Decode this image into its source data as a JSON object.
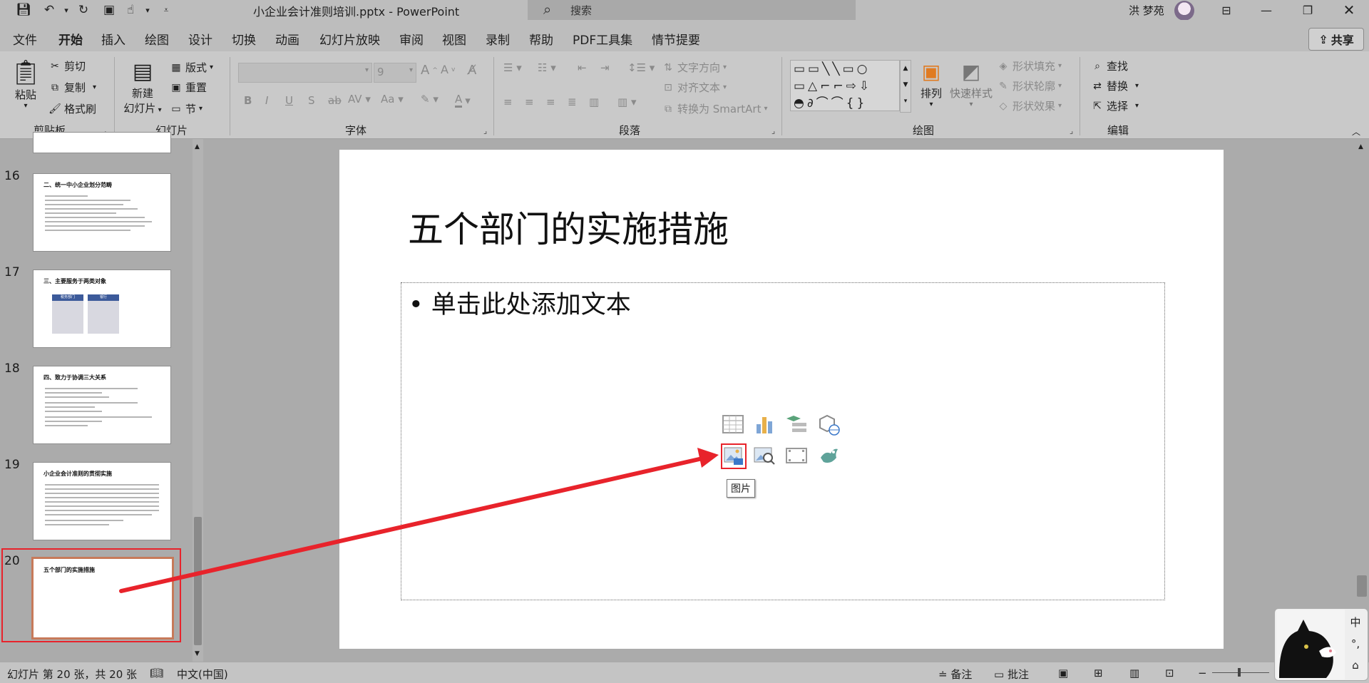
{
  "window": {
    "doc_title": "小企业会计准则培训.pptx  -  PowerPoint",
    "search_placeholder": "搜索",
    "user_name": "洪 梦苑",
    "qat_icons": [
      "save-icon",
      "undo-icon",
      "redo-icon",
      "presenter-icon",
      "touch-mode-icon",
      "customize-icon"
    ]
  },
  "tabs": [
    "文件",
    "开始",
    "插入",
    "绘图",
    "设计",
    "切换",
    "动画",
    "幻灯片放映",
    "审阅",
    "视图",
    "录制",
    "帮助",
    "PDF工具集",
    "情节提要"
  ],
  "active_tab": "开始",
  "share_label": "共享",
  "ribbon": {
    "clipboard": {
      "paste": "粘贴",
      "cut": "剪切",
      "copy": "复制",
      "format_painter": "格式刷",
      "group": "剪贴板"
    },
    "slides": {
      "new_slide_line1": "新建",
      "new_slide_line2": "幻灯片",
      "layout": "版式",
      "reset": "重置",
      "section": "节",
      "group": "幻灯片"
    },
    "font": {
      "size": "9",
      "group": "字体"
    },
    "paragraph": {
      "text_direction": "文字方向",
      "align_text": "对齐文本",
      "smartart": "转换为 SmartArt",
      "group": "段落"
    },
    "drawing": {
      "arrange": "排列",
      "quick_styles": "快速样式",
      "shape_fill": "形状填充",
      "shape_outline": "形状轮廓",
      "shape_effects": "形状效果",
      "group": "绘图"
    },
    "editing": {
      "find": "查找",
      "replace": "替换",
      "select": "选择",
      "group": "编辑"
    }
  },
  "thumbnails": [
    {
      "num": "16",
      "title": "二、统一中小企业划分范畴"
    },
    {
      "num": "17",
      "title": "三、主要服务于两类对象",
      "box1": "税务部门",
      "box2": "银行"
    },
    {
      "num": "18",
      "title": "四、致力于协调三大关系"
    },
    {
      "num": "19",
      "title": "小企业会计准则的贯彻实施"
    },
    {
      "num": "20",
      "title": "五个部门的实施措施"
    }
  ],
  "selected_slide": "20",
  "slide": {
    "title": "五个部门的实施措施",
    "placeholder_text": "• 单击此处添加文本",
    "insert_icons": [
      "table-icon",
      "chart-icon",
      "smartart-icon",
      "3d-model-icon",
      "picture-icon",
      "stock-images-icon",
      "video-icon",
      "icons-icon"
    ],
    "tooltip": "图片"
  },
  "status": {
    "slide_info": "幻灯片 第 20 张，共 20 张",
    "language": "中文(中国)",
    "notes": "备注",
    "comments": "批注"
  },
  "ime": {
    "mode": "中",
    "punct": "°,"
  },
  "colors": {
    "accent": "#c43e1c",
    "annotation": "#e8232b"
  }
}
